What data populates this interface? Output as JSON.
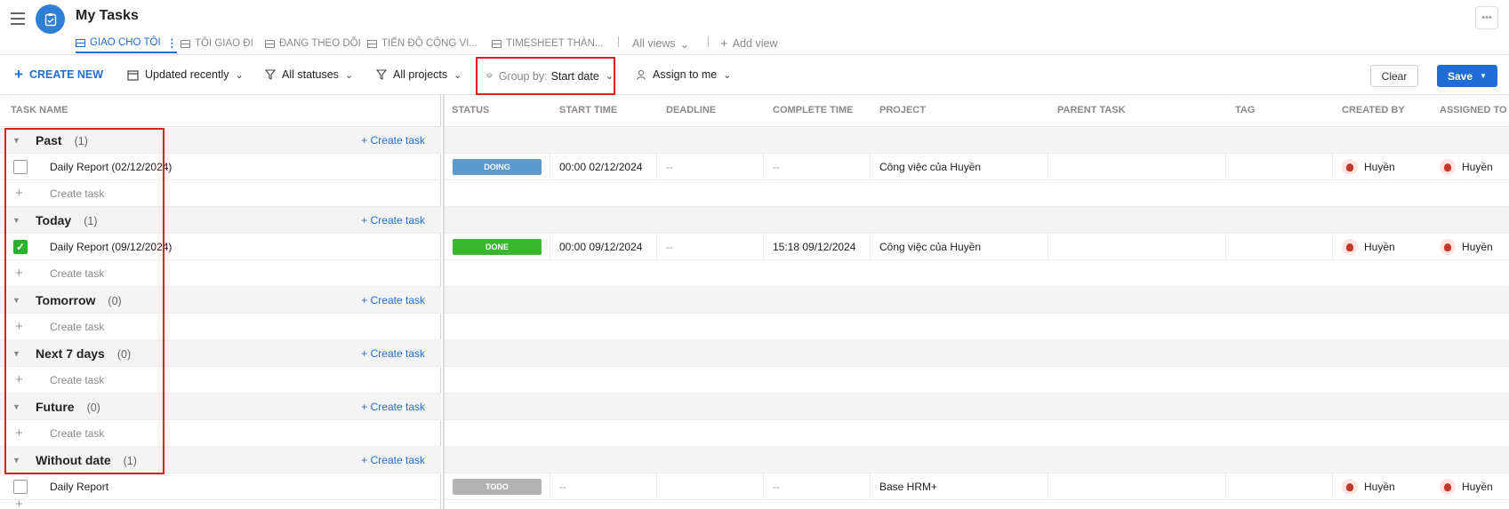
{
  "header": {
    "title": "My Tasks",
    "tabs": [
      {
        "label": "GIAO CHO TÔI",
        "active": true
      },
      {
        "label": "TÔI GIAO ĐI",
        "active": false
      },
      {
        "label": "ĐANG THEO DÕI",
        "active": false
      },
      {
        "label": "TIẾN ĐỘ CÔNG VI...",
        "active": false
      },
      {
        "label": "TIMESHEET THÀN...",
        "active": false
      }
    ],
    "all_views_label": "All views",
    "add_view_label": "Add view",
    "more_label": "•••"
  },
  "toolbar": {
    "create_new_label": "CREATE NEW",
    "sort_label": "Updated recently",
    "status_filter_label": "All statuses",
    "project_filter_label": "All projects",
    "group_by_prefix": "Group by:",
    "group_by_value": "Start date",
    "assign_filter_label": "Assign to me",
    "clear_label": "Clear",
    "save_label": "Save"
  },
  "table": {
    "columns": [
      "TASK NAME",
      "STATUS",
      "START TIME",
      "DEADLINE",
      "COMPLETE TIME",
      "PROJECT",
      "PARENT TASK",
      "TAG",
      "CREATED BY",
      "ASSIGNED TO"
    ],
    "create_task_link": "+ Create task",
    "create_task_label": "Create task",
    "groups": [
      {
        "name": "Past",
        "count": "(1)",
        "tasks": [
          {
            "name": "Daily Report (02/12/2024)",
            "done": false,
            "status": "DOING",
            "status_color": "#5b9bd1",
            "start": "00:00 02/12/2024",
            "deadline": "--",
            "complete": "--",
            "project": "Công việc của Huyền",
            "created_by": "Huyền",
            "assigned_to": "Huyền"
          }
        ]
      },
      {
        "name": "Today",
        "count": "(1)",
        "tasks": [
          {
            "name": "Daily Report (09/12/2024)",
            "done": true,
            "status": "DONE",
            "status_color": "#3ab52e",
            "start": "00:00 09/12/2024",
            "deadline": "--",
            "complete": "15:18 09/12/2024",
            "project": "Công việc của Huyền",
            "created_by": "Huyền",
            "assigned_to": "Huyền"
          }
        ]
      },
      {
        "name": "Tomorrow",
        "count": "(0)",
        "tasks": []
      },
      {
        "name": "Next 7 days",
        "count": "(0)",
        "tasks": []
      },
      {
        "name": "Future",
        "count": "(0)",
        "tasks": []
      },
      {
        "name": "Without date",
        "count": "(1)",
        "tasks": [
          {
            "name": "Daily Report",
            "done": false,
            "status": "TODO",
            "status_color": "#b3b3b3",
            "start": "--",
            "deadline": "",
            "complete": "--",
            "project": "Base HRM+",
            "created_by": "Huyền",
            "assigned_to": "Huyền"
          }
        ]
      }
    ]
  },
  "colors": {
    "accent": "#1e6ed6",
    "highlight_box": "#e02020"
  }
}
